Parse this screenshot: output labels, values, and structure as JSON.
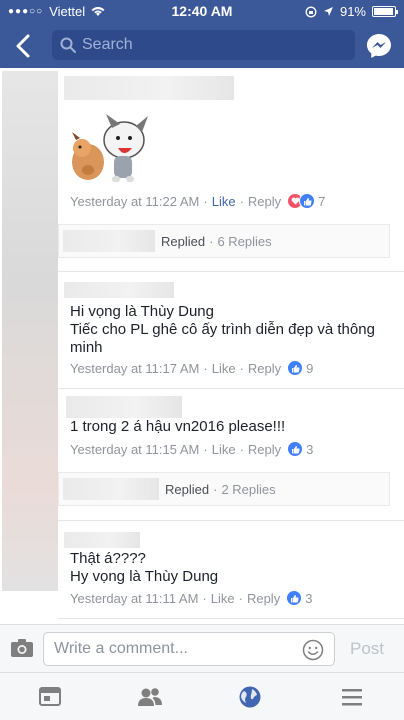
{
  "status_bar": {
    "carrier": "Viettel",
    "time": "12:40 AM",
    "battery": "91%"
  },
  "nav": {
    "search_placeholder": "Search"
  },
  "comments": [
    {
      "timestamp": "Yesterday at 11:22 AM",
      "like_label": "Like",
      "reply_label": "Reply",
      "reaction_count": "7",
      "reactions": [
        "love",
        "like"
      ],
      "liked": true
    },
    {
      "text_lines": [
        "Hi vọng là Thùy Dung",
        "Tiếc cho PL ghê cô ấy trình diễn đẹp và thông minh"
      ],
      "timestamp": "Yesterday at 11:17 AM",
      "like_label": "Like",
      "reply_label": "Reply",
      "reaction_count": "9"
    },
    {
      "text_lines": [
        "1 trong 2 á hậu vn2016 please!!!"
      ],
      "timestamp": "Yesterday at 11:15 AM",
      "like_label": "Like",
      "reply_label": "Reply",
      "reaction_count": "3"
    },
    {
      "text_lines": [
        "Thật á????",
        "Hy vọng là Thùy Dung"
      ],
      "timestamp": "Yesterday at 11:11 AM",
      "like_label": "Like",
      "reply_label": "Reply",
      "reaction_count": "3"
    }
  ],
  "replied_bars": [
    {
      "label": "Replied",
      "count": "6 Replies"
    },
    {
      "label": "Replied",
      "count": "2 Replies"
    }
  ],
  "composer": {
    "placeholder": "Write a comment...",
    "post_label": "Post"
  },
  "colors": {
    "brand": "#3b5998",
    "like_blue": "#4080ff",
    "love_red": "#f25268",
    "meta_gray": "#90949c"
  },
  "tabs": [
    "news-feed-icon",
    "friends-icon",
    "globe-icon",
    "menu-icon"
  ]
}
